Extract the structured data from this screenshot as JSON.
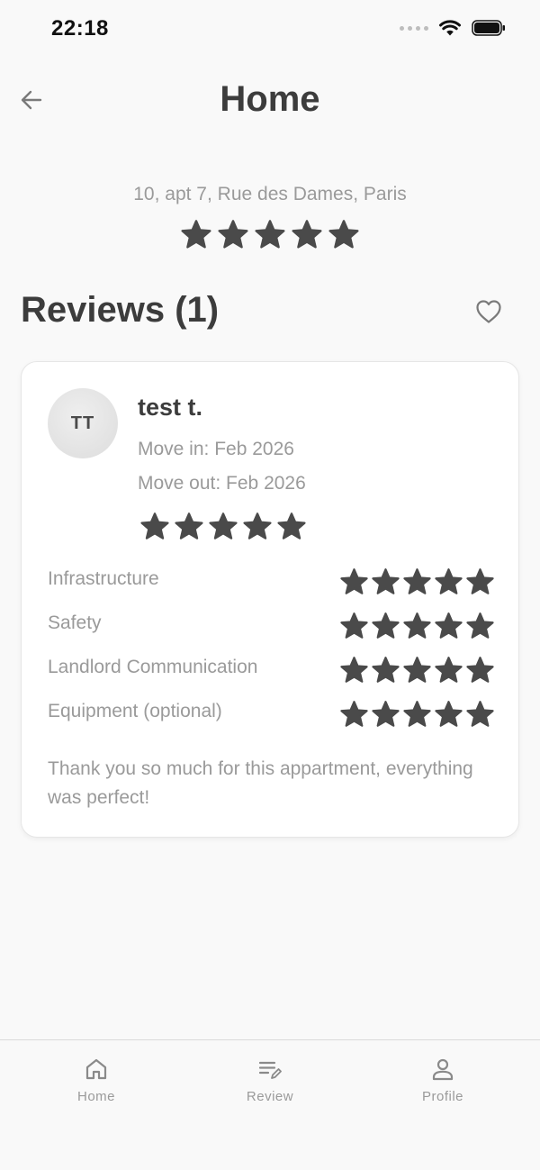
{
  "status_bar": {
    "time": "22:18"
  },
  "header": {
    "title": "Home"
  },
  "property": {
    "address": "10, apt 7, Rue des Dames, Paris",
    "overall_rating": 5
  },
  "reviews_section": {
    "title": "Reviews (1)"
  },
  "review": {
    "initials": "TT",
    "name": "test t.",
    "move_in": "Move in: Feb 2026",
    "move_out": "Move out: Feb 2026",
    "rating": 5,
    "categories": [
      {
        "label": "Infrastructure",
        "rating": 5
      },
      {
        "label": "Safety",
        "rating": 5
      },
      {
        "label": "Landlord Communication",
        "rating": 5
      },
      {
        "label": "Equipment (optional)",
        "rating": 5
      }
    ],
    "comment": "Thank you so much for this appartment, everything was perfect!"
  },
  "tabbar": {
    "items": [
      {
        "label": "Home",
        "icon": "home-icon"
      },
      {
        "label": "Review",
        "icon": "review-edit-icon"
      },
      {
        "label": "Profile",
        "icon": "profile-icon"
      }
    ]
  },
  "colors": {
    "star": "#4a4a4a",
    "muted_text": "#9a9a9a",
    "title_text": "#3c3c3c"
  }
}
